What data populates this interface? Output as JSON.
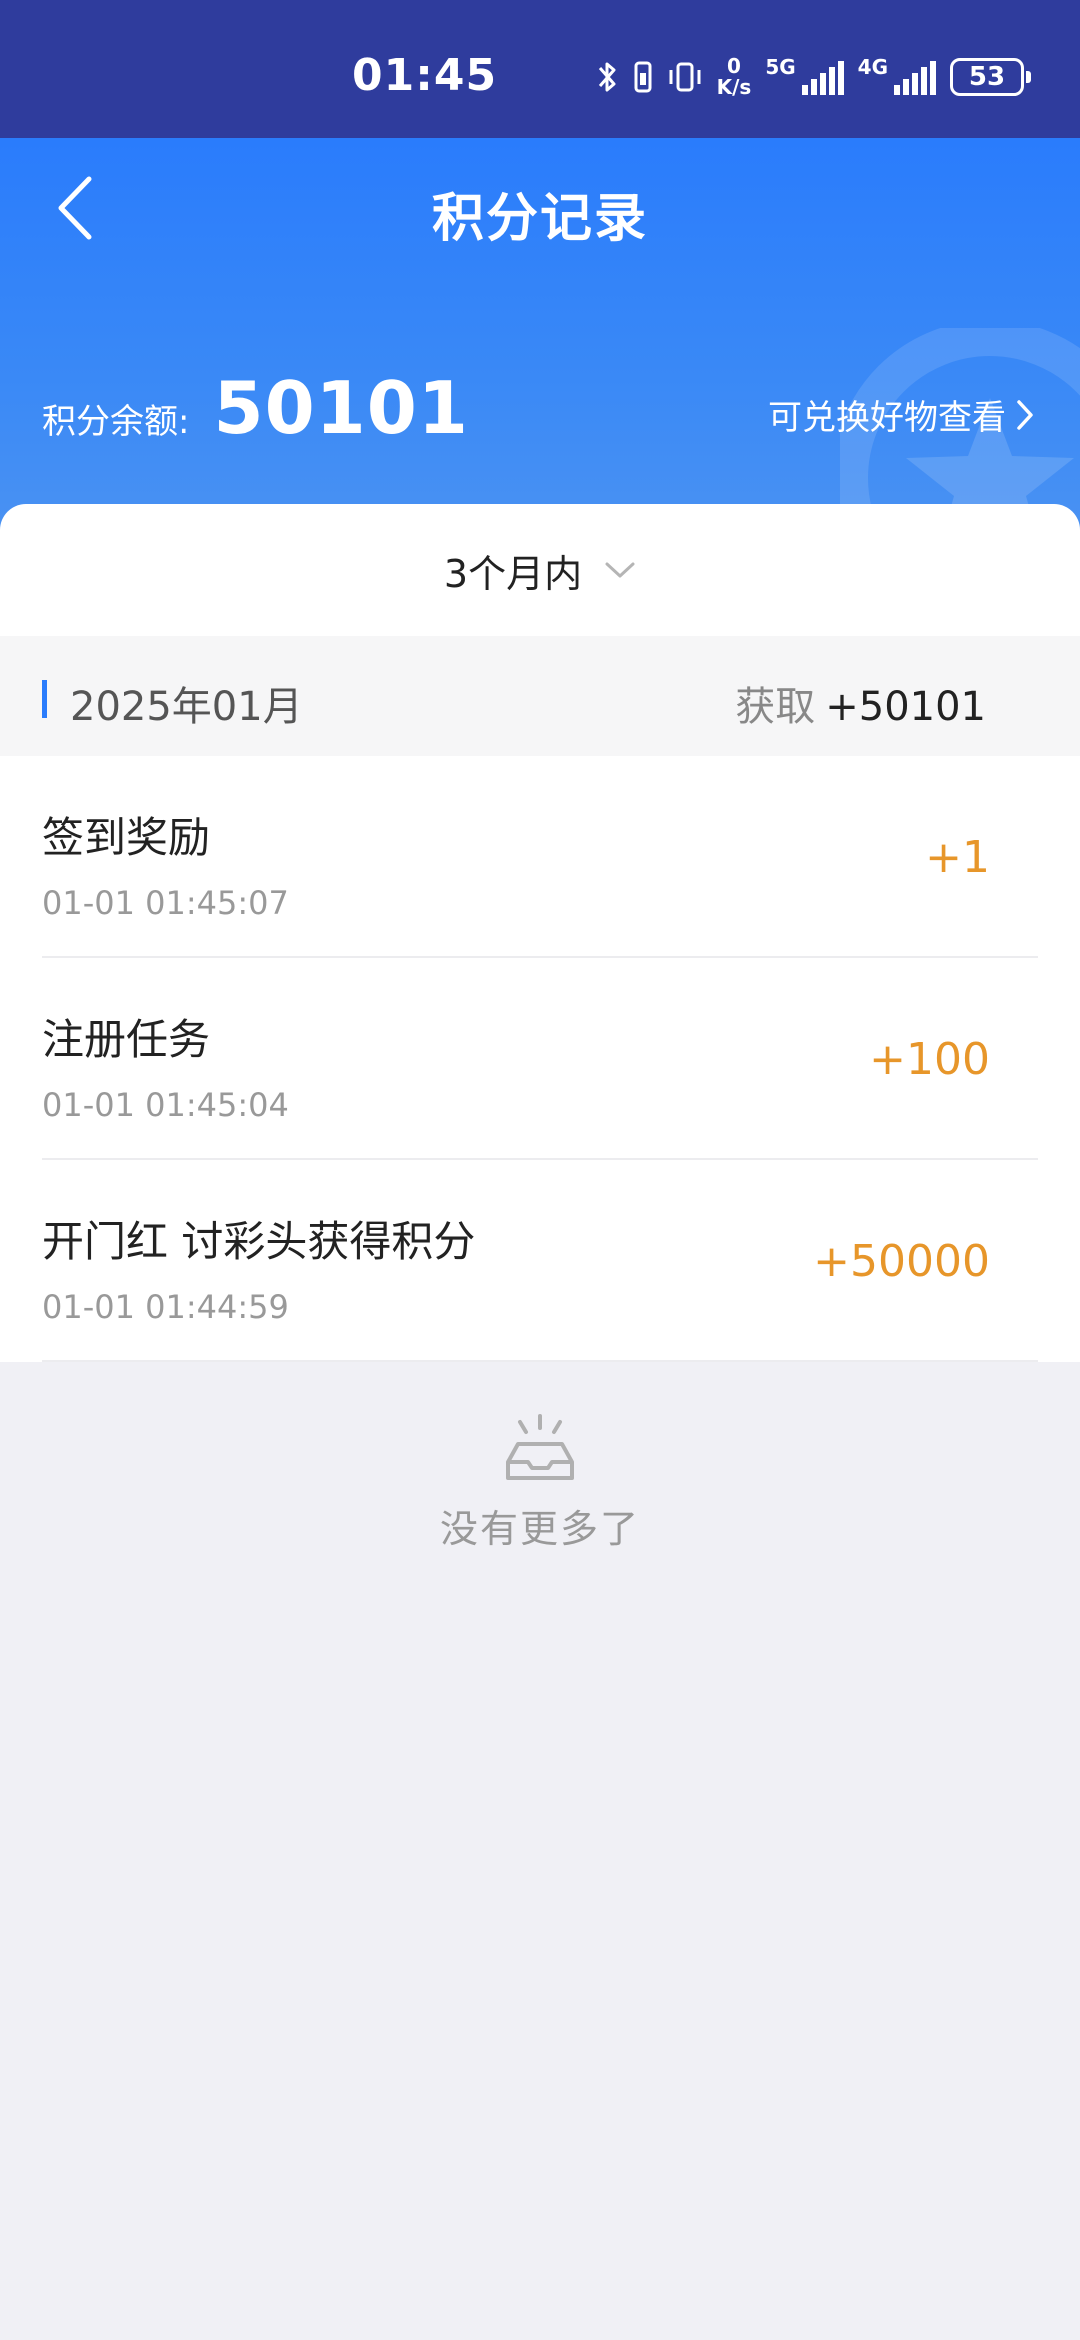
{
  "status_bar": {
    "time": "01:45",
    "speed_value": "0",
    "speed_unit": "K/s",
    "network1": "5G",
    "network2": "4G",
    "battery": "53"
  },
  "header": {
    "title": "积分记录",
    "balance_label": "积分余额:",
    "balance_value": "50101",
    "exchange_link": "可兑换好物查看"
  },
  "filter": {
    "label": "3个月内"
  },
  "month": {
    "label": "2025年01月",
    "summary_label": "获取",
    "summary_value": "+50101"
  },
  "records": [
    {
      "name": "签到奖励",
      "time": "01-01 01:45:07",
      "points": "+1"
    },
    {
      "name": "注册任务",
      "time": "01-01 01:45:04",
      "points": "+100"
    },
    {
      "name": "开门红 讨彩头获得积分",
      "time": "01-01 01:44:59",
      "points": "+50000"
    }
  ],
  "empty": {
    "text": "没有更多了"
  },
  "colors": {
    "status_bar_bg": "#2f3c9d",
    "header_blue": "#2a7cfc",
    "points_orange": "#e7962a",
    "page_bg": "#f0f0f5"
  }
}
